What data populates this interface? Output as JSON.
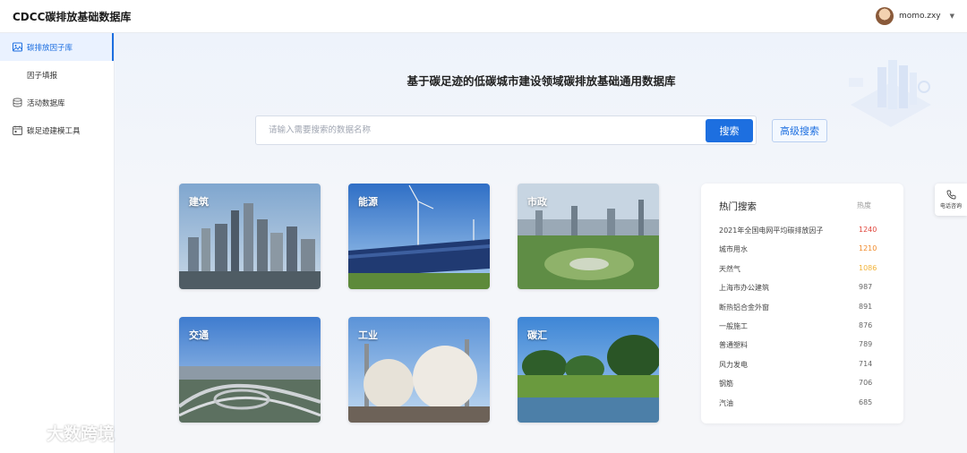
{
  "header": {
    "app_title": "CDCC碳排放基础数据库",
    "username": "momo.zxy"
  },
  "sidebar": {
    "items": [
      {
        "label": "碳排放因子库",
        "icon": "image-icon",
        "active": true
      },
      {
        "label": "因子填报",
        "icon": "",
        "active": false
      },
      {
        "label": "活动数据库",
        "icon": "database-icon",
        "active": false
      },
      {
        "label": "碳足迹建模工具",
        "icon": "calendar-icon",
        "active": false
      }
    ]
  },
  "main": {
    "title": "基于碳足迹的低碳城市建设领域碳排放基础通用数据库",
    "search": {
      "placeholder": "请输入需要搜索的数据名称",
      "button_label": "搜索",
      "advanced_label": "高级搜索"
    },
    "cards": [
      {
        "label": "建筑"
      },
      {
        "label": "能源"
      },
      {
        "label": "市政"
      },
      {
        "label": "交通"
      },
      {
        "label": "工业"
      },
      {
        "label": "碳汇"
      }
    ],
    "hot_search": {
      "title": "热门搜索",
      "column": "热度",
      "items": [
        {
          "name": "2021年全国电网平均碳排放因子",
          "value": "1240",
          "color": "#e0463c"
        },
        {
          "name": "城市用水",
          "value": "1210",
          "color": "#f08a2a"
        },
        {
          "name": "天然气",
          "value": "1086",
          "color": "#f2b43a"
        },
        {
          "name": "上海市办公建筑",
          "value": "987",
          "color": "#666666"
        },
        {
          "name": "断热铝合金外窗",
          "value": "891",
          "color": "#666666"
        },
        {
          "name": "一般施工",
          "value": "876",
          "color": "#666666"
        },
        {
          "name": "普通塑料",
          "value": "789",
          "color": "#666666"
        },
        {
          "name": "风力发电",
          "value": "714",
          "color": "#666666"
        },
        {
          "name": "钢筋",
          "value": "706",
          "color": "#666666"
        },
        {
          "name": "汽油",
          "value": "685",
          "color": "#666666"
        }
      ]
    }
  },
  "float": {
    "phone_label": "电话咨询"
  },
  "watermark": {
    "text": "大数跨境"
  },
  "colors": {
    "accent": "#1d6fe0"
  }
}
